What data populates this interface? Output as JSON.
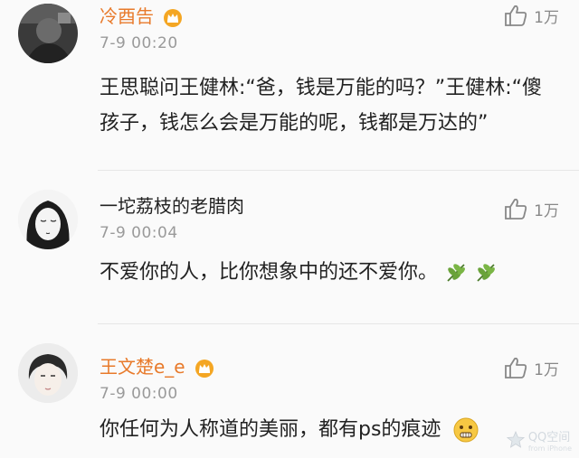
{
  "comments": [
    {
      "username": "冷酉告",
      "time": "7-9 00:20",
      "likes": "1万",
      "text": "王思聪问王健林:“爸，钱是万能的吗？”王健林:“傻孩子，钱怎么会是万能的呢，钱都是万达的”",
      "vip": true,
      "avatar_icon": "avatar-dark-man-icon"
    },
    {
      "username": "一坨荔枝的老腊肉",
      "time": "7-9 00:04",
      "likes": "1万",
      "text": "不爱你的人，比你想象中的还不爱你。",
      "vip": false,
      "trailing_icon": "leaf-icon",
      "avatar_icon": "avatar-sketch-girl-icon"
    },
    {
      "username": "王文楚e_e",
      "time": "7-9 00:00",
      "likes": "1万",
      "text": "你任何为人称道的美丽，都有ps的痕迹",
      "vip": true,
      "trailing_icon": "grimace-emoji-icon",
      "avatar_icon": "avatar-boy-icon"
    }
  ],
  "watermark": {
    "title": "QQ空间",
    "subtitle": "from iPhone"
  },
  "colors": {
    "vip_name": "#e87a2b",
    "time": "#9a9a9a",
    "text": "#222222"
  }
}
